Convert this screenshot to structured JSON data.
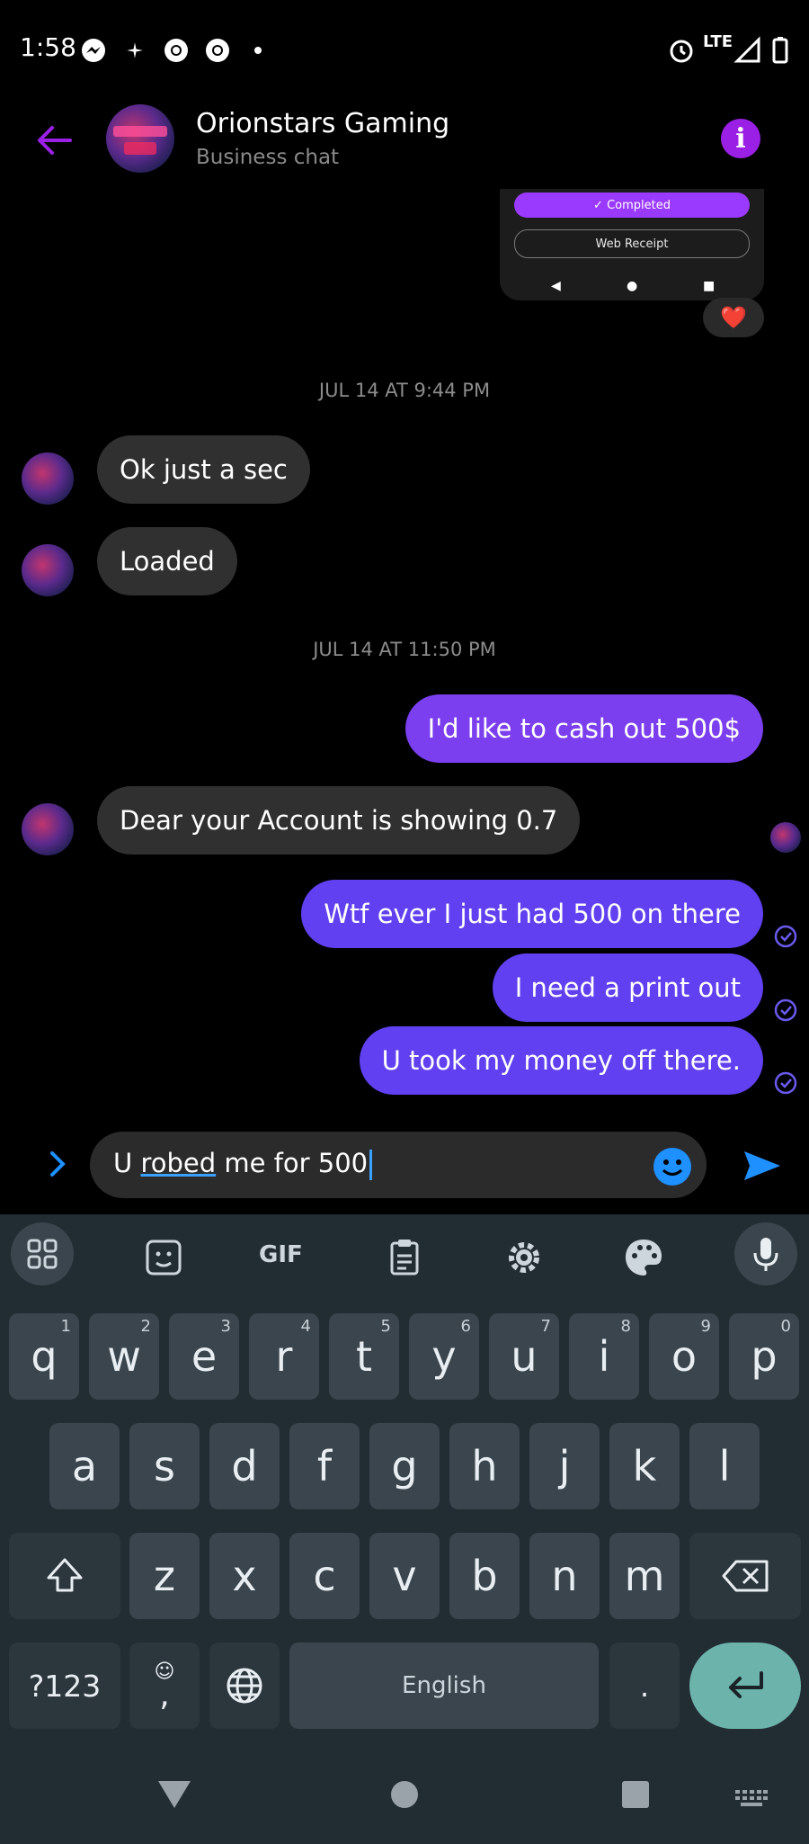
{
  "status_bar": {
    "time": "1:58",
    "network": "LTE",
    "icons": [
      "messenger-icon",
      "pinwheel-icon",
      "chrome-icon",
      "chrome-icon",
      "dot-icon",
      "alarm-icon",
      "signal-icon",
      "battery-icon"
    ]
  },
  "header": {
    "title": "Orionstars Gaming",
    "subtitle": "Business chat"
  },
  "image_preview": {
    "completed_label": "Completed",
    "receipt_label": "Web Receipt",
    "reaction": "❤️"
  },
  "timestamps": [
    "JUL 14 AT 9:44 PM",
    "JUL 14 AT 11:50 PM"
  ],
  "messages": [
    {
      "from": "them",
      "text": "Ok just a sec"
    },
    {
      "from": "them",
      "text": "Loaded"
    },
    {
      "from": "me",
      "text": "I'd like to cash out 500$"
    },
    {
      "from": "them",
      "text": "Dear your Account is showing 0.7"
    },
    {
      "from": "me",
      "text": "Wtf ever I just had 500 on there"
    },
    {
      "from": "me",
      "text": "I need a print out"
    },
    {
      "from": "me",
      "text": "U took my money off there."
    }
  ],
  "composer": {
    "text_before": "U ",
    "text_underlined": "robed",
    "text_after": " me for 500"
  },
  "keyboard": {
    "toolbar": [
      "apps-icon",
      "sticker-icon",
      "GIF",
      "clipboard-icon",
      "settings-icon",
      "palette-icon",
      "mic-icon"
    ],
    "row1": [
      [
        "q",
        "1"
      ],
      [
        "w",
        "2"
      ],
      [
        "e",
        "3"
      ],
      [
        "r",
        "4"
      ],
      [
        "t",
        "5"
      ],
      [
        "y",
        "6"
      ],
      [
        "u",
        "7"
      ],
      [
        "i",
        "8"
      ],
      [
        "o",
        "9"
      ],
      [
        "p",
        "0"
      ]
    ],
    "row2": [
      "a",
      "s",
      "d",
      "f",
      "g",
      "h",
      "j",
      "k",
      "l"
    ],
    "row3": [
      "z",
      "x",
      "c",
      "v",
      "b",
      "n",
      "m"
    ],
    "symbols_label": "?123",
    "comma_label": ",",
    "space_label": "English",
    "period_label": "."
  },
  "colors": {
    "accent_purple": "#9b20e6",
    "outgoing_bubble": "#6040f0",
    "incoming_bubble": "#303030",
    "send_blue": "#1e90ff",
    "keyboard_bg": "#222c33",
    "enter_key": "#6cb3ac"
  }
}
